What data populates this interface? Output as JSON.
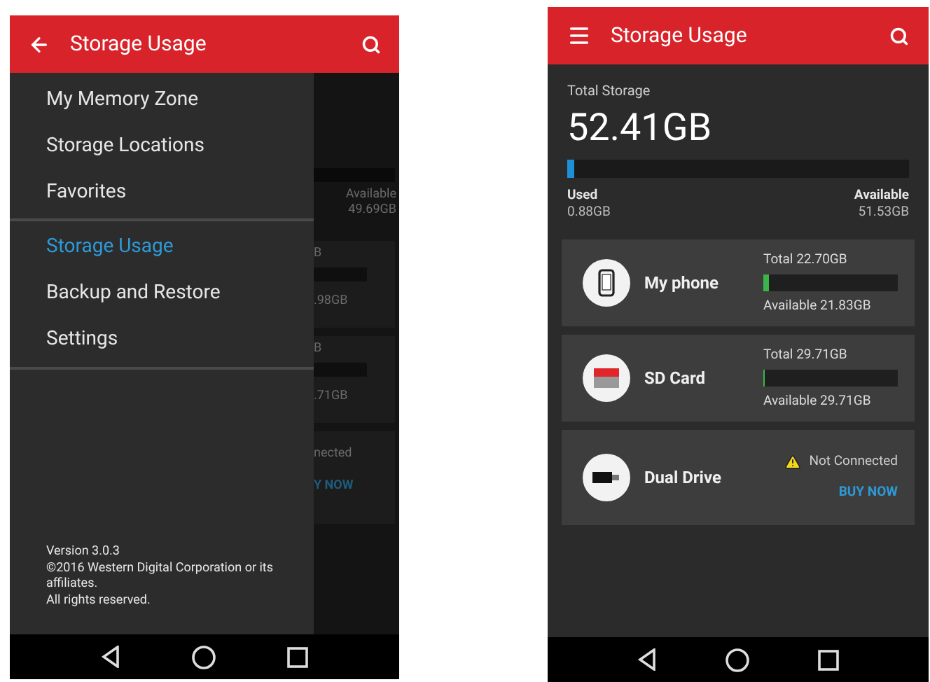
{
  "left_phone": {
    "app_bar": {
      "title": "Storage Usage"
    },
    "drawer": {
      "items": [
        {
          "label": "My Memory Zone",
          "selected": false
        },
        {
          "label": "Storage Locations",
          "selected": false
        },
        {
          "label": "Favorites",
          "selected": false
        },
        {
          "label": "Storage Usage",
          "selected": true
        },
        {
          "label": "Backup and Restore",
          "selected": false
        },
        {
          "label": "Settings",
          "selected": false
        }
      ],
      "footer": [
        "Version 3.0.3",
        "©2016 Western Digital Corporation or its affiliates.",
        "All rights reserved."
      ]
    },
    "background_fragments": {
      "total_available_label": "Available",
      "total_available_value": "49.69GB",
      "card_1_total": "B",
      "card_1_available": ".98GB",
      "card_2_total": "B",
      "card_2_available": ".71GB",
      "card_3_status": "nected",
      "card_3_action": "Y NOW"
    }
  },
  "right_phone": {
    "app_bar": {
      "title": "Storage Usage"
    },
    "total": {
      "label": "Total Storage",
      "value": "52.41GB",
      "level": 0.02,
      "used_label": "Used",
      "used_value": "0.88GB",
      "available_label": "Available",
      "available_value": "51.53GB"
    },
    "devices": [
      {
        "kind": "phone",
        "name": "My phone",
        "connected": true,
        "total": "Total 22.70GB",
        "level": 0.04,
        "available": "Available 21.83GB"
      },
      {
        "kind": "sdcard",
        "name": "SD Card",
        "connected": true,
        "total": "Total 29.71GB",
        "level": 0.01,
        "available": "Available 29.71GB"
      },
      {
        "kind": "drive",
        "name": "Dual Drive",
        "connected": false,
        "status": "Not Connected",
        "action": "BUY NOW"
      }
    ]
  }
}
